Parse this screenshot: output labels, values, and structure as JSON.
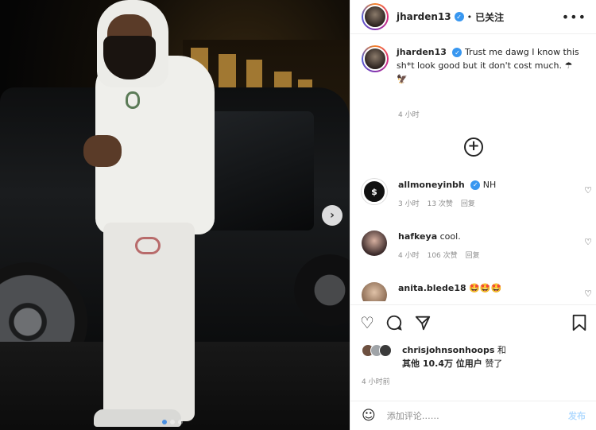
{
  "post": {
    "author": "jharden13",
    "follow_status": "已关注",
    "more_icon": "more-horizontal-icon",
    "separator": "•"
  },
  "caption": {
    "username": "jharden13",
    "text": "Trust me dawg I know this sh*t look good but it don't cost much. ☂ 🦅",
    "time": "4 小时"
  },
  "comments": [
    {
      "username": "allmoneyinbh",
      "verified": true,
      "text": "NH",
      "time": "3 小时",
      "likes": "13 次赞",
      "reply": "回复",
      "avatar_color": "#111111"
    },
    {
      "username": "hafkeya",
      "verified": false,
      "text": "cool.",
      "time": "4 小时",
      "likes": "106 次赞",
      "reply": "回复",
      "avatar_color": "#3b2a2a"
    },
    {
      "username": "anita.blede18",
      "verified": false,
      "text": "🤩🤩🤩",
      "time": "",
      "likes": "",
      "reply": "",
      "avatar_color": "#c9a48a"
    }
  ],
  "actions": {
    "like_icon": "heart-icon",
    "comment_icon": "comment-icon",
    "share_icon": "share-icon",
    "save_icon": "bookmark-icon"
  },
  "likes": {
    "first_user": "chrisjohnsonhoops",
    "conj": "和",
    "others": "其他 10.4万 位用户",
    "suffix": "赞了",
    "post_time": "4 小时前"
  },
  "add_comment": {
    "placeholder": "添加评论……",
    "post_label": "发布"
  },
  "carousel": {
    "slides": 3,
    "active": 1
  },
  "colors": {
    "verified": "#3897f0",
    "link_disabled": "#b3dbff",
    "meta": "#8e8e8e"
  }
}
